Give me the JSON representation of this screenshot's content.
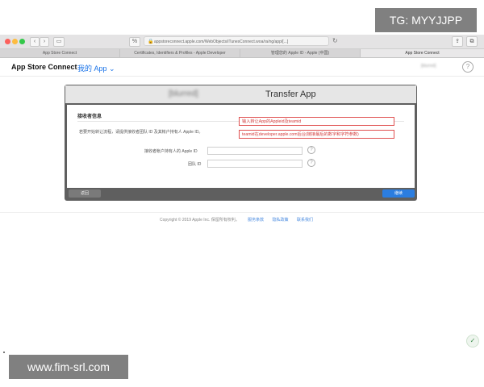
{
  "browser": {
    "url": "appstoreconnect.apple.com/WebObjects/iTunesConnect.woa/ra/ng/app/[...]",
    "tabs": [
      "App Store Connect",
      "Certificates, Identifiers & Profiles - Apple Developer",
      "管理您的 Apple ID - Apple (中国)",
      "App Store Connect"
    ],
    "icons": [
      "back-icon",
      "forward-icon",
      "sidebar-icon",
      "privacy-icon",
      "lock-icon",
      "reload-icon",
      "share-icon",
      "new-tab-icon"
    ]
  },
  "app": {
    "brand": "App Store Connect",
    "my_apps": "我的 App ⌄",
    "account_name": "[blurred]",
    "help": "?"
  },
  "modal": {
    "title_blurred": "[blurred]",
    "title": "Transfer App",
    "section_title": "接收者信息",
    "description": "若要开始转让流程，请提供接收者团队 ID 及其帐户持有人 Apple ID。",
    "fields": [
      {
        "label": "接收者帐户持有人的 Apple ID",
        "value": ""
      },
      {
        "label": "团队 ID",
        "value": ""
      }
    ],
    "annotations": [
      "输入转让App的Appleid及teamid",
      "teamid在developer.apple.com后台(链接最后的数字和字符参数)"
    ],
    "back_button": "返回",
    "next_button": "继续"
  },
  "footer": {
    "copyright": "Copyright © 2019 Apple Inc. 保留所有权利。",
    "links": [
      "服务条款",
      "隐私政策",
      "联系我们"
    ]
  },
  "watermarks": {
    "top_right": "TG: MYYJJPP",
    "bottom_left": "www.fim-srl.com"
  },
  "colors": {
    "accent_blue": "#2b7de0",
    "annotation_red": "#d23b3b",
    "modal_frame": "#5f5f5f"
  }
}
